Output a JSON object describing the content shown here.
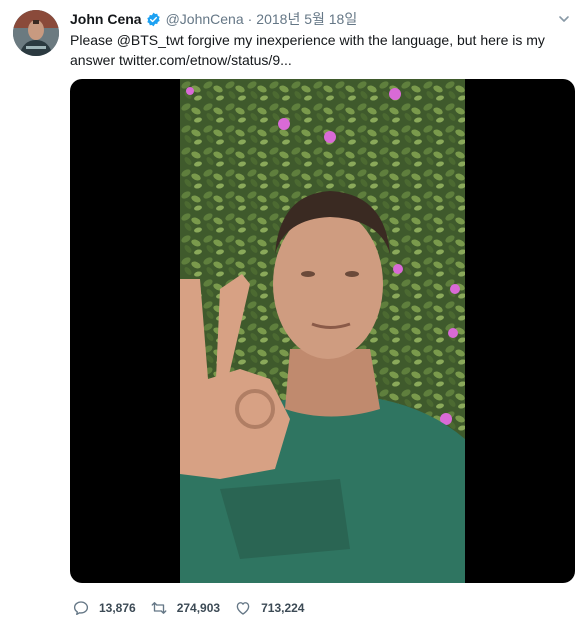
{
  "tweet": {
    "author_name": "John Cena",
    "handle": "@JohnCena",
    "separator": "·",
    "date": "2018년 5월 18일",
    "text_prefix": "Please ",
    "mention": "@BTS_twt",
    "text_middle": " forgive my inexperience with the language, but here is my answer ",
    "link": "twitter.com/etnow/status/9..."
  },
  "actions": {
    "replies": "13,876",
    "retweets": "274,903",
    "likes": "713,224"
  },
  "icons": [
    "verified-badge-icon",
    "chevron-down-icon",
    "reply-icon",
    "retweet-icon",
    "like-icon"
  ],
  "colors": {
    "text": "#14171a",
    "secondary": "#657786",
    "verified": "#1da1f2",
    "media_background": "#000000"
  }
}
